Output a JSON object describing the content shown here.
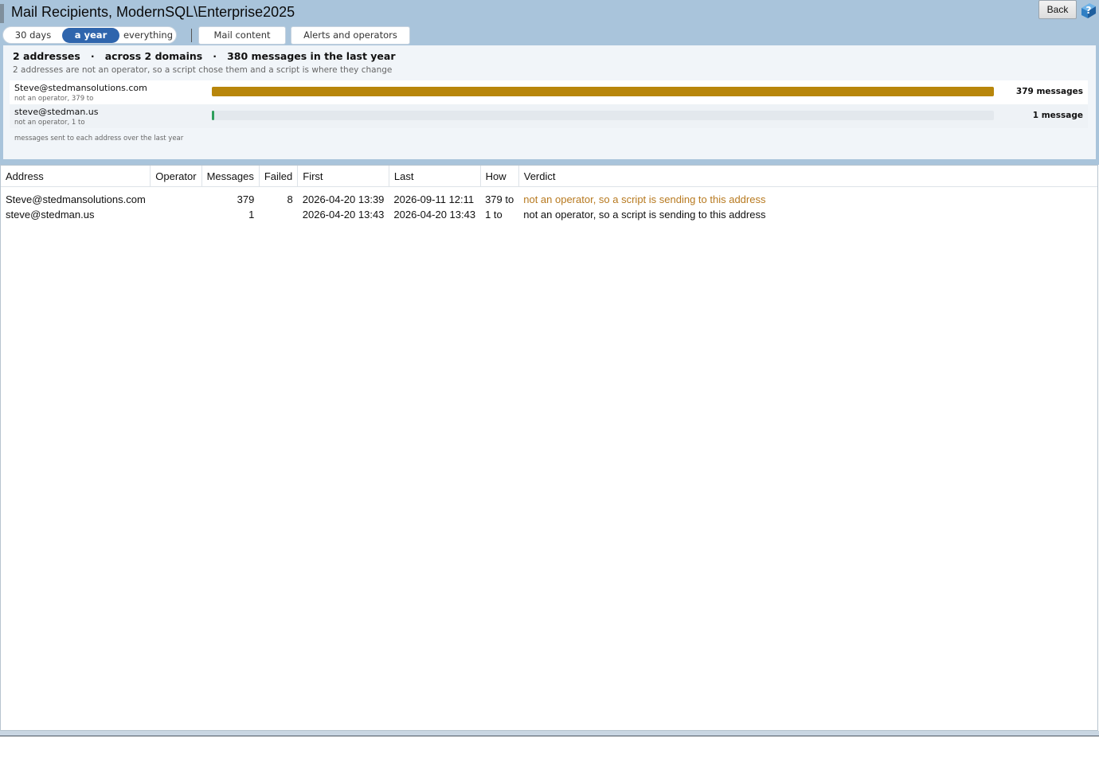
{
  "window": {
    "title": "Mail Recipients, ModernSQL\\Enterprise2025"
  },
  "toolbar": {
    "back_label": "Back",
    "help_icon": "help-question-icon",
    "ranges": [
      {
        "label": "30 days",
        "active": false
      },
      {
        "label": "a year",
        "active": true
      },
      {
        "label": "everything",
        "active": false
      }
    ],
    "tabs": [
      {
        "label": "Mail content"
      },
      {
        "label": "Alerts and operators"
      }
    ]
  },
  "summary": {
    "addresses": "2 addresses",
    "domains": "across 2 domains",
    "messages": "380 messages in the last year",
    "separator": "·",
    "subtitle": "2 addresses are not an operator, so a script chose them and a script is where they change",
    "bars": [
      {
        "address": "Steve@stedmansolutions.com",
        "note": "not an operator, 379 to",
        "count_label": "379 messages",
        "value": 379,
        "color": "#b8860b"
      },
      {
        "address": "steve@stedman.us",
        "note": "not an operator, 1 to",
        "count_label": "1 message",
        "value": 1,
        "color": "#2e9e5b"
      }
    ],
    "bar_max": 379,
    "footnote": "messages sent to each address over the last year"
  },
  "grid": {
    "columns": [
      "Address",
      "Operator",
      "Messages",
      "Failed",
      "First",
      "Last",
      "How",
      "Verdict"
    ],
    "rows": [
      {
        "address": "Steve@stedmansolutions.com",
        "operator": "",
        "messages": "379",
        "failed": "8",
        "first": "2026-04-20 13:39",
        "last": "2026-09-11 12:11",
        "how": "379 to",
        "verdict": "not an operator, so a script is sending to this address"
      },
      {
        "address": "steve@stedman.us",
        "operator": "",
        "messages": "1",
        "failed": "",
        "first": "2026-04-20 13:43",
        "last": "2026-04-20 13:43",
        "how": "1 to",
        "verdict": "not an operator, so a script is sending to this address"
      }
    ]
  },
  "colors": {
    "header_bg": "#a9c4db",
    "accent": "#2f65ad",
    "warn": "#b7791f"
  }
}
